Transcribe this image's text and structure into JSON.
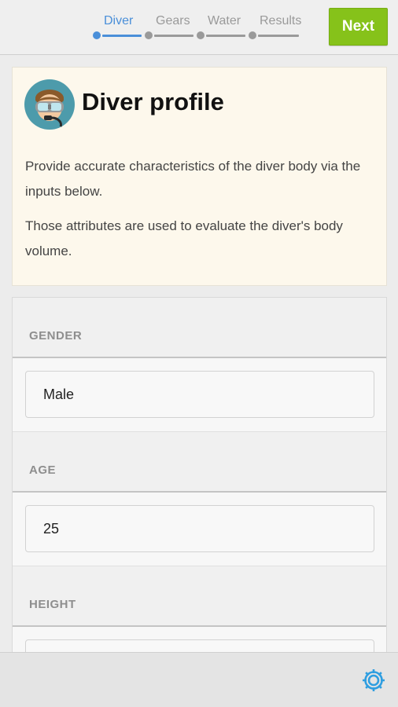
{
  "wizard": {
    "steps": [
      {
        "label": "Diver",
        "active": true
      },
      {
        "label": "Gears",
        "active": false
      },
      {
        "label": "Water",
        "active": false
      },
      {
        "label": "Results",
        "active": false
      }
    ],
    "next_label": "Next"
  },
  "profile": {
    "title": "Diver profile",
    "avatar_icon": "diver-avatar-icon",
    "description": [
      "Provide accurate characteristics of the diver body via the inputs below.",
      "Those attributes are used to evaluate the diver's body volume."
    ]
  },
  "form": {
    "fields": [
      {
        "label": "GENDER",
        "value": "Male"
      },
      {
        "label": "AGE",
        "value": "25"
      },
      {
        "label": "HEIGHT",
        "value": ""
      }
    ]
  },
  "footer": {
    "settings_icon": "gear-icon"
  },
  "colors": {
    "accent_blue": "#4a8fd9",
    "next_green": "#86c21a",
    "card_background": "#fdf8ec"
  }
}
